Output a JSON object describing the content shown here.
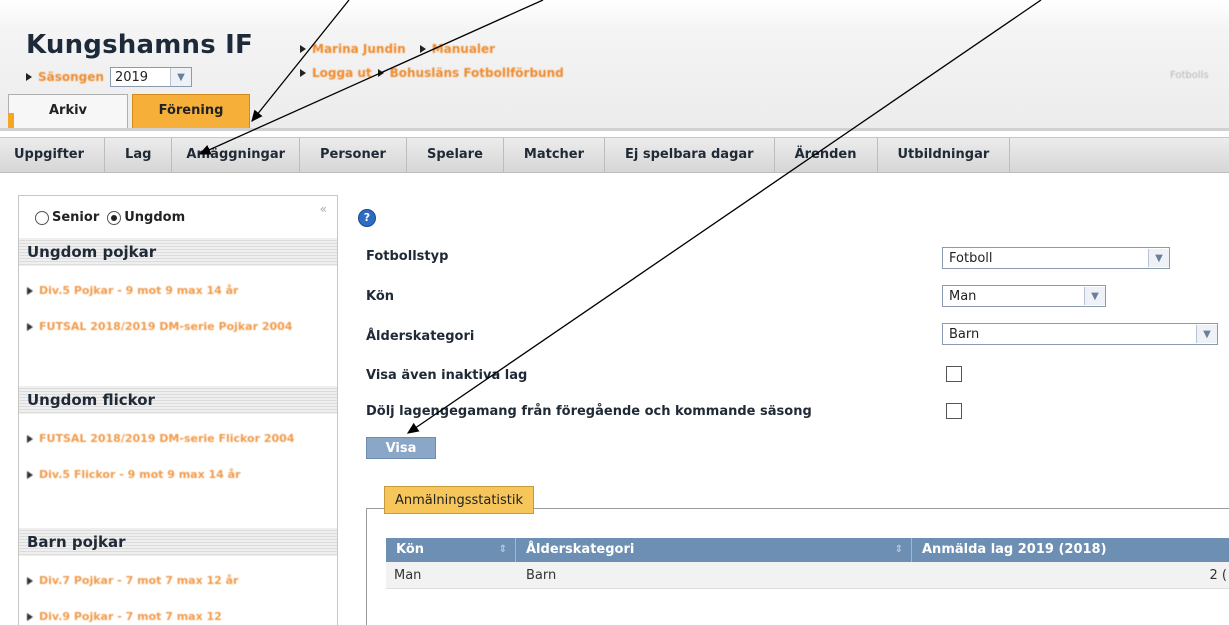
{
  "header": {
    "club_name": "Kungshamns IF",
    "season_label": "Säsongen",
    "season_value": "2019",
    "links_row1": [
      "Marina Jundin",
      "Manualer"
    ],
    "links_row2": [
      "Logga ut",
      "Bohusläns Fotbollförbund"
    ],
    "right_faded": "Fotbolls"
  },
  "tabs": [
    {
      "label": "Arkiv",
      "active": false
    },
    {
      "label": "Förening",
      "active": true
    }
  ],
  "menu": [
    "Uppgifter",
    "Lag",
    "Anläggningar",
    "Personer",
    "Spelare",
    "Matcher",
    "Ej spelbara dagar",
    "Ärenden",
    "Utbildningar"
  ],
  "left_panel": {
    "collapse_glyph": "«",
    "radio_options": [
      {
        "label": "Senior",
        "checked": false
      },
      {
        "label": "Ungdom",
        "checked": true
      }
    ],
    "sections": [
      {
        "title": "Ungdom pojkar",
        "links": [
          "Div.5 Pojkar - 9 mot 9 max 14 år",
          "FUTSAL 2018/2019 DM-serie Pojkar 2004"
        ]
      },
      {
        "title": "Ungdom flickor",
        "links": [
          "FUTSAL 2018/2019 DM-serie Flickor 2004",
          "Div.5 Flickor - 9 mot 9 max 14 år"
        ]
      },
      {
        "title": "Barn pojkar",
        "links": [
          "Div.7 Pojkar - 7 mot 7 max 12 år",
          "Div.9 Pojkar - 7 mot 7 max 12"
        ]
      }
    ]
  },
  "form": {
    "help_glyph": "?",
    "fields": [
      {
        "label": "Fotbollstyp",
        "value": "Fotboll"
      },
      {
        "label": "Kön",
        "value": "Man"
      },
      {
        "label": "Ålderskategori",
        "value": "Barn"
      }
    ],
    "checkbox_inactive_label": "Visa även inaktiva lag",
    "checkbox_hide_label": "Dölj lagengegamang från föregående och kommande säsong",
    "visa_label": "Visa"
  },
  "stats": {
    "legend": "Anmälningsstatistik",
    "columns": [
      "Kön",
      "Ålderskategori",
      "Anmälda lag 2019 (2018)"
    ],
    "rows": [
      [
        "Man",
        "Barn",
        "2 ("
      ]
    ]
  },
  "colors": {
    "accent_orange": "#f6b03a",
    "link_orange": "#f19a4a",
    "table_header": "#6d8fb3"
  }
}
